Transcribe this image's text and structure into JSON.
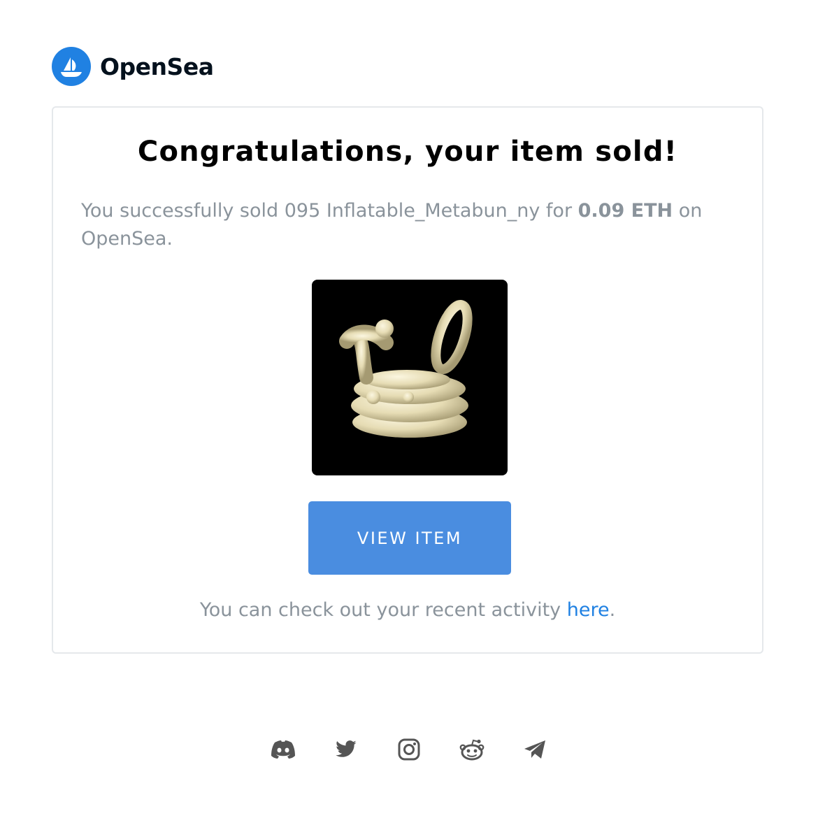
{
  "brand": {
    "name": "OpenSea",
    "logo_icon": "opensea-ship-icon",
    "logo_color": "#2081e2"
  },
  "card": {
    "title": "Congratulations, your item sold!",
    "message_before": "You successfully sold 095 Inflatable_Metabun_ny for ",
    "price": "0.09 ETH",
    "message_after": " on OpenSea.",
    "image_icon": "inflatable-balloon-bunny-image",
    "button_label": "VIEW ITEM",
    "button_color": "#4a8de0",
    "activity_text": "You can check out your recent activity ",
    "activity_link": "here",
    "activity_end": "."
  },
  "social": {
    "icons": [
      "discord-icon",
      "twitter-icon",
      "instagram-icon",
      "reddit-icon",
      "telegram-icon"
    ]
  },
  "colors": {
    "text_muted": "#8a939b",
    "link": "#2081e2",
    "card_border": "#e5e8eb"
  }
}
